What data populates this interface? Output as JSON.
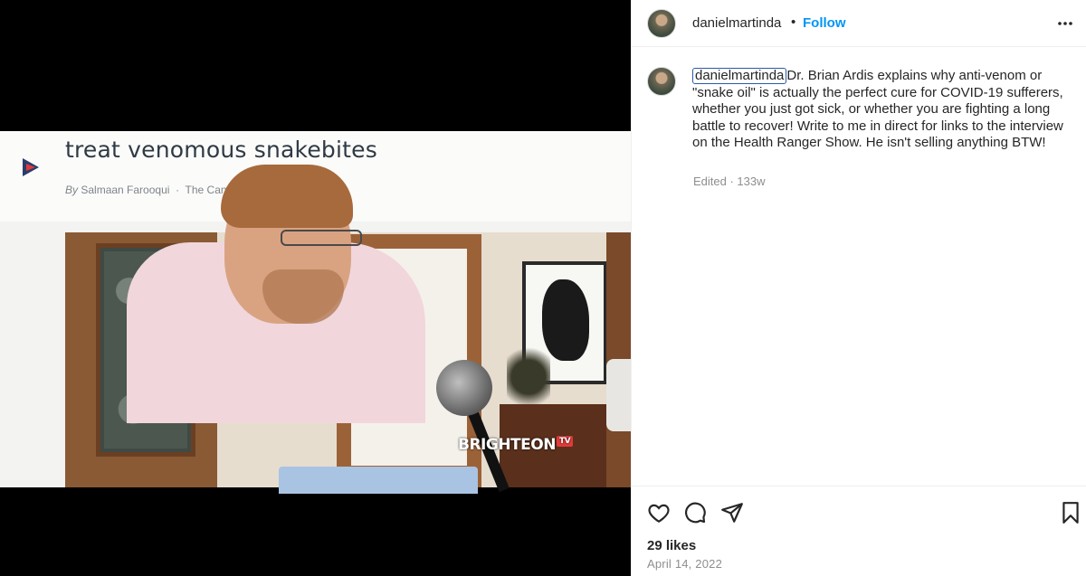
{
  "post": {
    "username": "danielmartinda",
    "follow_label": "Follow",
    "separator": "•",
    "caption_username": "danielmartinda",
    "caption_text": "Dr. Brian Ardis explains why anti-venom or \"snake oil\" is actually the perfect cure for COVID-19 sufferers, whether you just got sick, or whether you are fighting a long battle to recover! Write to me in direct for links to the interview on the Health Ranger Show. He isn't selling anything BTW!",
    "caption_meta": "Edited · 133w",
    "likes": "29 likes",
    "date": "April 14, 2022"
  },
  "media": {
    "article_title": "treat venomous snakebites",
    "article_byline_by": "By",
    "article_byline_author": "Salmaan Farooqui",
    "article_byline_sep": "·",
    "article_byline_source": "The Can",
    "watermark": "BRIGHTEON",
    "watermark_tv": "TV"
  },
  "icons": {
    "more": "more-horizontal-icon",
    "like": "heart-icon",
    "comment": "comment-icon",
    "share": "send-icon",
    "save": "bookmark-icon",
    "media_logo": "play-logo-icon"
  },
  "colors": {
    "follow": "#0095f6",
    "text": "#262626",
    "muted": "#8e8e8e",
    "media_bg": "#000000"
  }
}
